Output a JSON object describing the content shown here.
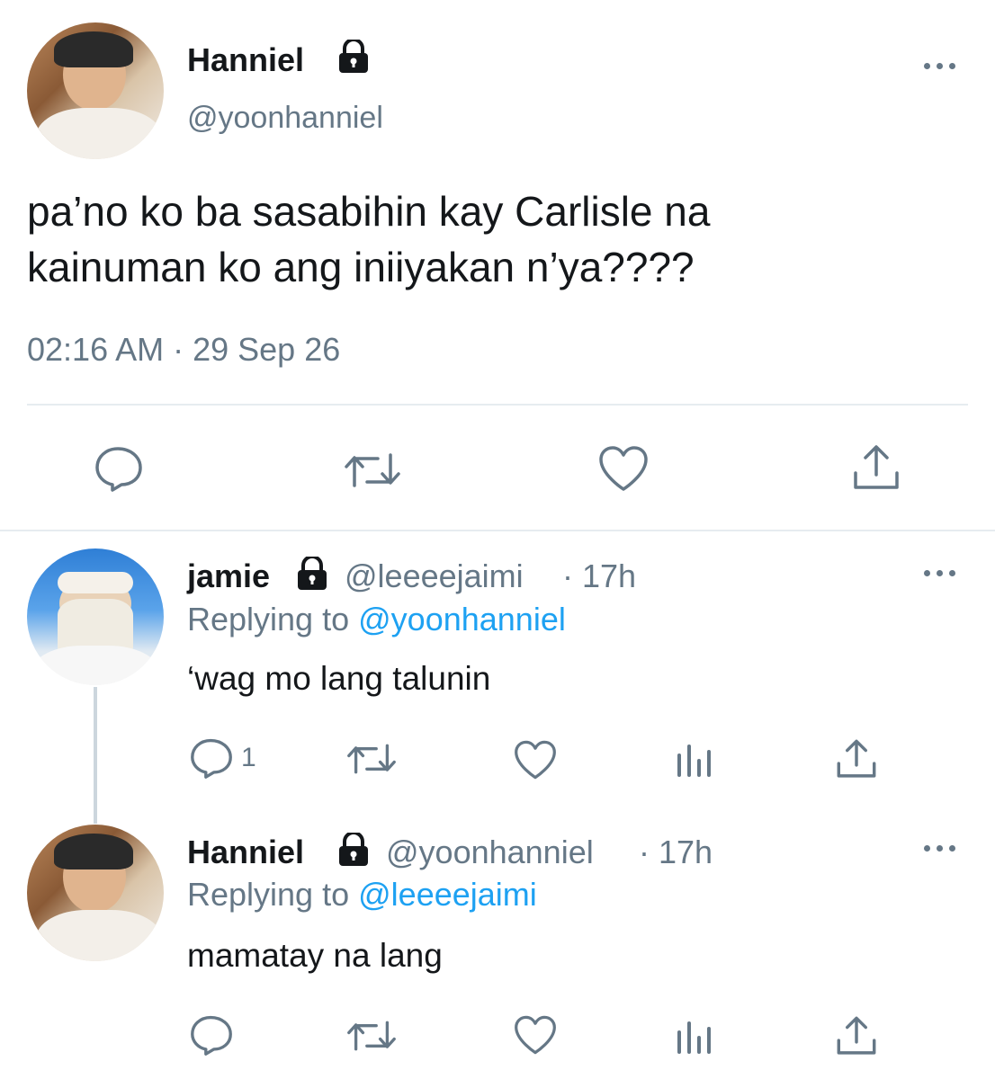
{
  "main_tweet": {
    "author_name": "Hanniel",
    "handle": "@yoonhanniel",
    "text_line1": "pa’no ko ba sasabihin kay Carlisle na",
    "text_line2": "kainuman ko ang iniiyakan n’ya????",
    "timestamp": "02:16 AM · 29 Sep 26",
    "actions": [
      "reply-icon",
      "retweet-icon",
      "like-icon",
      "share-icon"
    ]
  },
  "reply1": {
    "author_name": "jamie",
    "handle": "@leeeejaimi",
    "time": "· 17h",
    "replying_prefix": "Replying to",
    "replying_to": "@yoonhanniel",
    "text": "‘wag mo lang talunin",
    "reply_count": "1",
    "actions": [
      "reply-icon",
      "retweet-icon",
      "like-icon",
      "analytics-icon",
      "share-icon"
    ]
  },
  "reply2": {
    "author_name": "Hanniel",
    "handle": "@yoonhanniel",
    "time": "· 17h",
    "replying_prefix": "Replying to",
    "replying_to": "@leeeejaimi",
    "text": "mamatay na lang",
    "actions": [
      "reply-icon",
      "retweet-icon",
      "like-icon",
      "analytics-icon",
      "share-icon"
    ]
  },
  "colors": {
    "text": "#14171a",
    "muted": "#657786",
    "link": "#1da1f2",
    "divider": "#e6ecf0"
  }
}
